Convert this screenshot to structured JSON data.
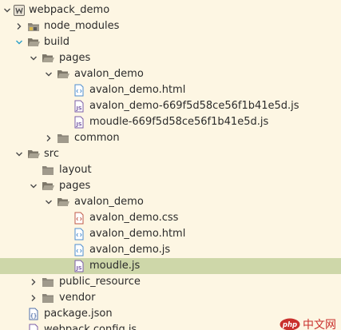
{
  "tree": {
    "rows": [
      {
        "label": "webpack_demo",
        "twisty": "down",
        "icon": "project-icon"
      },
      {
        "label": "node_modules",
        "twisty": "right",
        "icon": "folder-library-icon"
      },
      {
        "label": "build",
        "twisty": "down",
        "icon": "folder-open-icon"
      },
      {
        "label": "pages",
        "twisty": "down",
        "icon": "folder-open-icon"
      },
      {
        "label": "avalon_demo",
        "twisty": "down",
        "icon": "folder-open-icon"
      },
      {
        "label": "avalon_demo.html",
        "twisty": "",
        "icon": "html-file-icon"
      },
      {
        "label": "avalon_demo-669f5d58ce56f1b41e5d.js",
        "twisty": "",
        "icon": "js-file-icon"
      },
      {
        "label": "moudle-669f5d58ce56f1b41e5d.js",
        "twisty": "",
        "icon": "js-file-icon"
      },
      {
        "label": "common",
        "twisty": "right",
        "icon": "folder-icon"
      },
      {
        "label": "src",
        "twisty": "down",
        "icon": "folder-open-icon"
      },
      {
        "label": "layout",
        "twisty": "",
        "icon": "folder-icon"
      },
      {
        "label": "pages",
        "twisty": "down",
        "icon": "folder-open-icon"
      },
      {
        "label": "avalon_demo",
        "twisty": "down",
        "icon": "folder-open-icon"
      },
      {
        "label": "avalon_demo.css",
        "twisty": "",
        "icon": "css-file-icon"
      },
      {
        "label": "avalon_demo.html",
        "twisty": "",
        "icon": "html-file-icon"
      },
      {
        "label": "avalon_demo.js",
        "twisty": "",
        "icon": "js-file-icon"
      },
      {
        "label": "moudle.js",
        "twisty": "",
        "icon": "js-file-icon",
        "selected": true
      },
      {
        "label": "public_resource",
        "twisty": "right",
        "icon": "folder-icon"
      },
      {
        "label": "vendor",
        "twisty": "right",
        "icon": "folder-icon"
      },
      {
        "label": "package.json",
        "twisty": "",
        "icon": "json-file-icon"
      },
      {
        "label": "webpack.config.js",
        "twisty": "",
        "icon": "js-file-icon"
      }
    ]
  },
  "watermark": {
    "brand": "php",
    "text": "中文网"
  },
  "colors": {
    "background": "#fdf6e3",
    "selected_row": "#ced7a9",
    "text": "#2b2b2b",
    "twisty": "#4a4a4a",
    "twisty_hover": "#2aa0c8",
    "folder": "#8a8478",
    "js_file": "#7b5ea7",
    "html_file": "#4f8fcf",
    "css_file": "#c05a48",
    "watermark": "#c9302c"
  }
}
